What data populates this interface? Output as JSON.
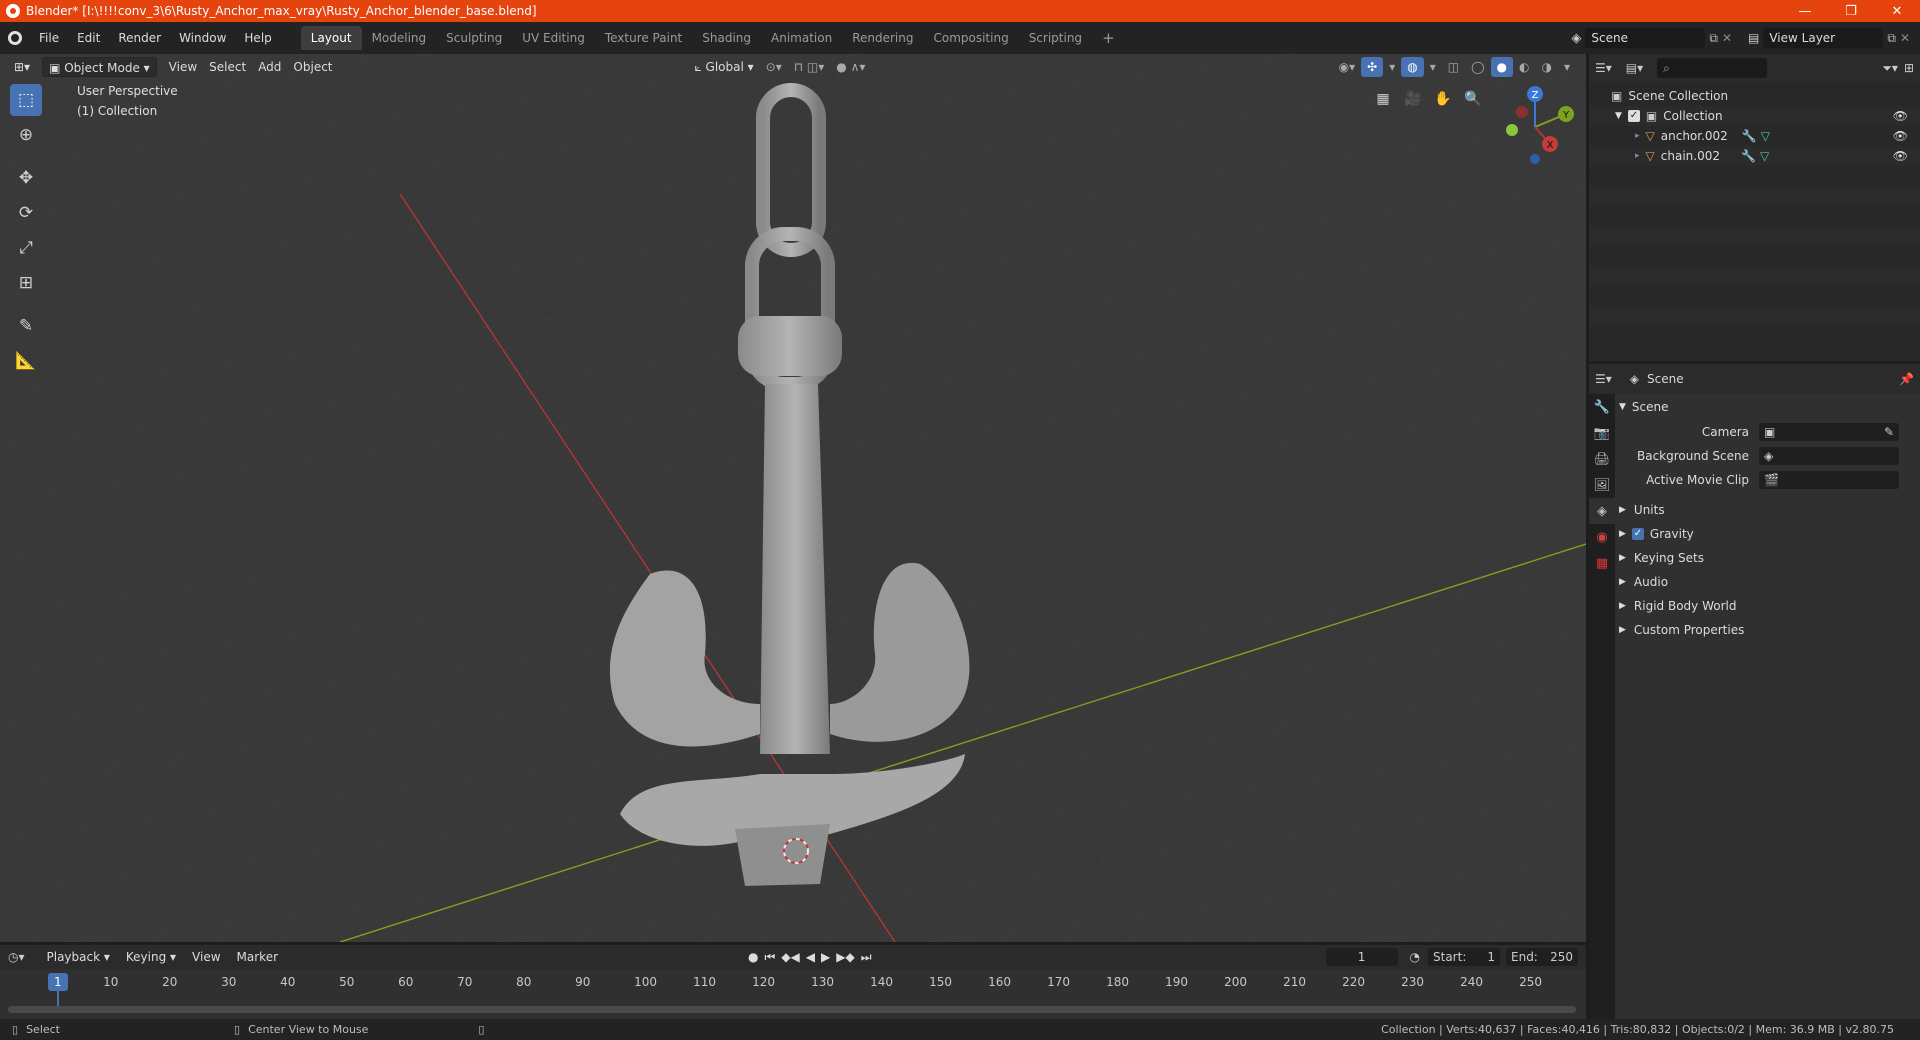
{
  "titlebar": {
    "title": "Blender* [I:\\!!!!conv_3\\6\\Rusty_Anchor_max_vray\\Rusty_Anchor_blender_base.blend]",
    "minimize": "—",
    "maximize": "❐",
    "close": "✕"
  },
  "menu": [
    "File",
    "Edit",
    "Render",
    "Window",
    "Help"
  ],
  "workspaces": [
    "Layout",
    "Modeling",
    "Sculpting",
    "UV Editing",
    "Texture Paint",
    "Shading",
    "Animation",
    "Rendering",
    "Compositing",
    "Scripting"
  ],
  "workspace_add": "+",
  "scene_field": "Scene",
  "viewlayer_field": "View Layer",
  "viewport": {
    "mode": "Object Mode",
    "menus": [
      "View",
      "Select",
      "Add",
      "Object"
    ],
    "orientation": "Global",
    "perspective_label": "User Perspective",
    "collection_label": "(1) Collection",
    "gizmo": {
      "x": "X",
      "y": "Y",
      "z": "Z"
    }
  },
  "outliner": {
    "search_placeholder": "",
    "root": "Scene Collection",
    "collection": "Collection",
    "objects": [
      "anchor.002",
      "chain.002"
    ]
  },
  "properties": {
    "context": "Scene",
    "panel_title": "Scene",
    "fields": [
      {
        "label": "Camera",
        "value": ""
      },
      {
        "label": "Background Scene",
        "value": ""
      },
      {
        "label": "Active Movie Clip",
        "value": ""
      }
    ],
    "sections": [
      "Units",
      "Gravity",
      "Keying Sets",
      "Audio",
      "Rigid Body World",
      "Custom Properties"
    ],
    "gravity_checked": true
  },
  "timeline": {
    "menus": [
      "Playback",
      "Keying",
      "View",
      "Marker"
    ],
    "current_frame": "1",
    "start_label": "Start:",
    "start": "1",
    "end_label": "End:",
    "end": "250",
    "ticks": [
      "1",
      "10",
      "20",
      "30",
      "40",
      "50",
      "60",
      "70",
      "80",
      "90",
      "100",
      "110",
      "120",
      "130",
      "140",
      "150",
      "160",
      "170",
      "180",
      "190",
      "200",
      "210",
      "220",
      "230",
      "240",
      "250"
    ]
  },
  "statusbar": {
    "left": "Select",
    "middle": "Center View to Mouse",
    "stats": "Collection | Verts:40,637 | Faces:40,416 | Tris:80,832 | Objects:0/2 | Mem: 36.9 MB | v2.80.75"
  },
  "colors": {
    "titlebar": "#e6440f",
    "accent": "#4772b3",
    "x_axis": "#b53434",
    "y_axis": "#7da320",
    "z_axis": "#3a79d8",
    "object_icon": "#e09a3e",
    "modifier_icon": "#6aa1e0",
    "mesh_icon": "#45c4a0"
  }
}
